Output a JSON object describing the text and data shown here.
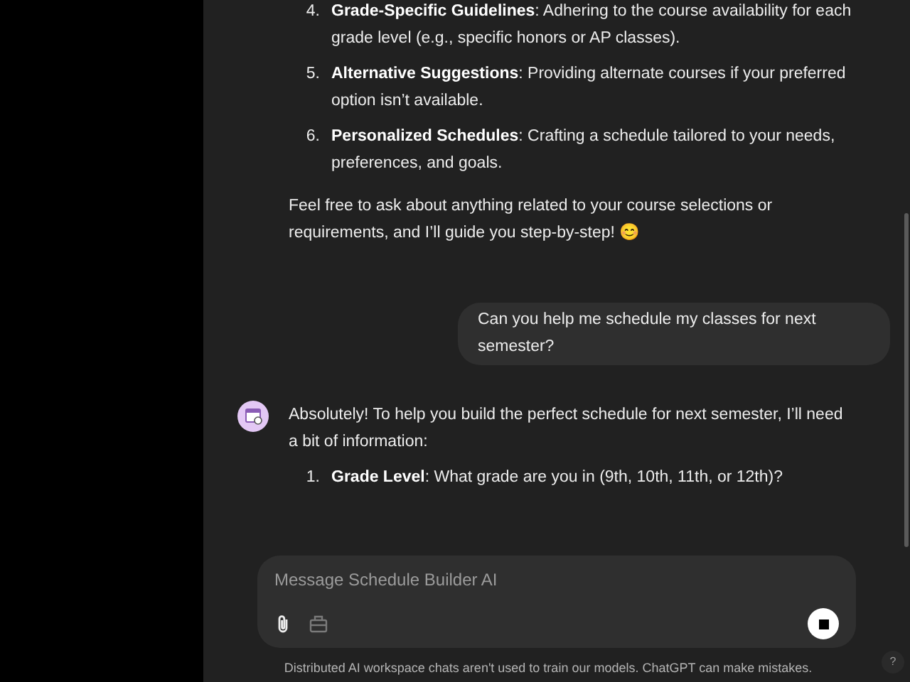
{
  "earlier_list": [
    {
      "number": "4.",
      "title": "Grade-Specific Guidelines",
      "text": ": Adhering to the course availability for each grade level (e.g., specific honors or AP classes)."
    },
    {
      "number": "5.",
      "title": "Alternative Suggestions",
      "text": ": Providing alternate courses if your preferred option isn’t available."
    },
    {
      "number": "6.",
      "title": "Personalized Schedules",
      "text": ": Crafting a schedule tailored to your needs, preferences, and goals."
    }
  ],
  "closing_paragraph": "Feel free to ask about anything related to your course selections or requirements, and I’ll guide you step-by-step! 😊",
  "user_message": "Can you help me schedule my classes for next semester?",
  "assistant_reply": {
    "intro": "Absolutely! To help you build the perfect schedule for next semester, I’ll need a bit of information:",
    "list": [
      {
        "number": "1.",
        "title": "Grade Level",
        "text": ": What grade are you in (9th, 10th, 11th, or 12th)?"
      }
    ]
  },
  "composer": {
    "placeholder": "Message Schedule Builder AI"
  },
  "footer": "Distributed AI workspace chats aren't used to train our models. ChatGPT can make mistakes.",
  "help_button": "?"
}
